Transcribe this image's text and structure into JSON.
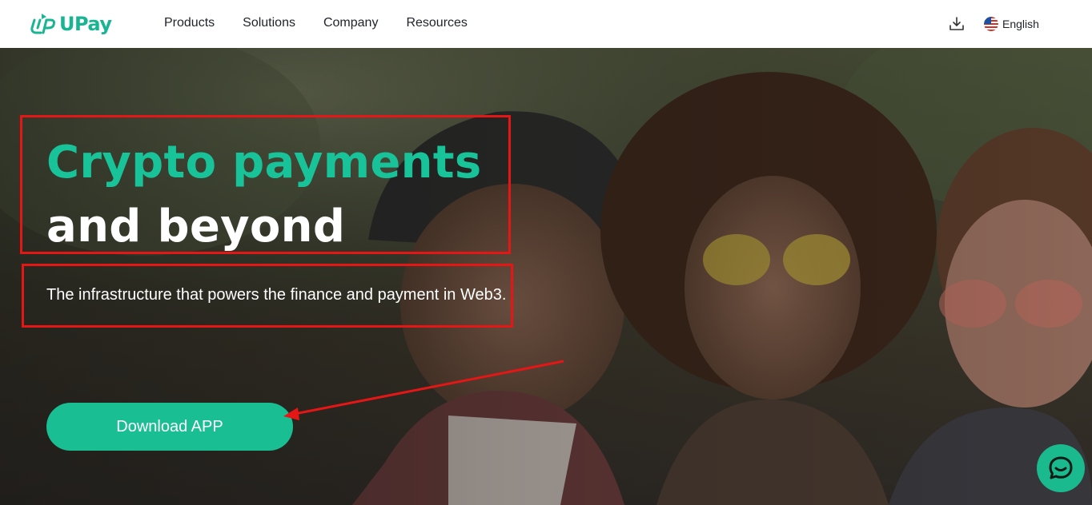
{
  "brand": {
    "name": "UPay",
    "color": "#19b592"
  },
  "nav": {
    "items": [
      "Products",
      "Solutions",
      "Company",
      "Resources"
    ]
  },
  "header": {
    "download_icon": "download-icon",
    "language": "English",
    "language_icon": "us-flag-icon"
  },
  "hero": {
    "headline_line1": "Crypto payments",
    "headline_line2": "and beyond",
    "subtitle": "The infrastructure that powers the finance and payment in Web3.",
    "cta_label": "Download APP",
    "accent_color": "#19c39a",
    "annotation_color": "#e51616"
  },
  "chat": {
    "icon": "chat-icon"
  }
}
